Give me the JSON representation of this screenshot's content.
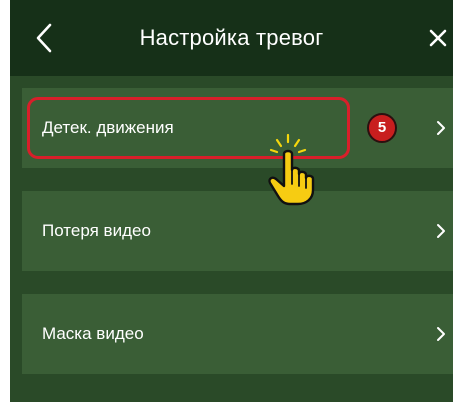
{
  "header": {
    "title": "Настройка тревог",
    "back_icon": "chevron-left-icon",
    "close_icon": "close-icon"
  },
  "list": {
    "items": [
      {
        "label": "Детек. движения",
        "icon": "chevron-right-icon"
      },
      {
        "label": "Потеря видео",
        "icon": "chevron-right-icon"
      },
      {
        "label": "Маска видео",
        "icon": "chevron-right-icon"
      }
    ]
  },
  "annotation": {
    "step_number": "5",
    "highlight_color": "#d81f2a",
    "badge_color": "#c81e1e",
    "pointer_icon": "hand-pointer-icon"
  },
  "colors": {
    "header_background": "#163018",
    "screen_background": "#2a4a28",
    "row_background": "#3a5e36",
    "text": "#ffffff"
  }
}
